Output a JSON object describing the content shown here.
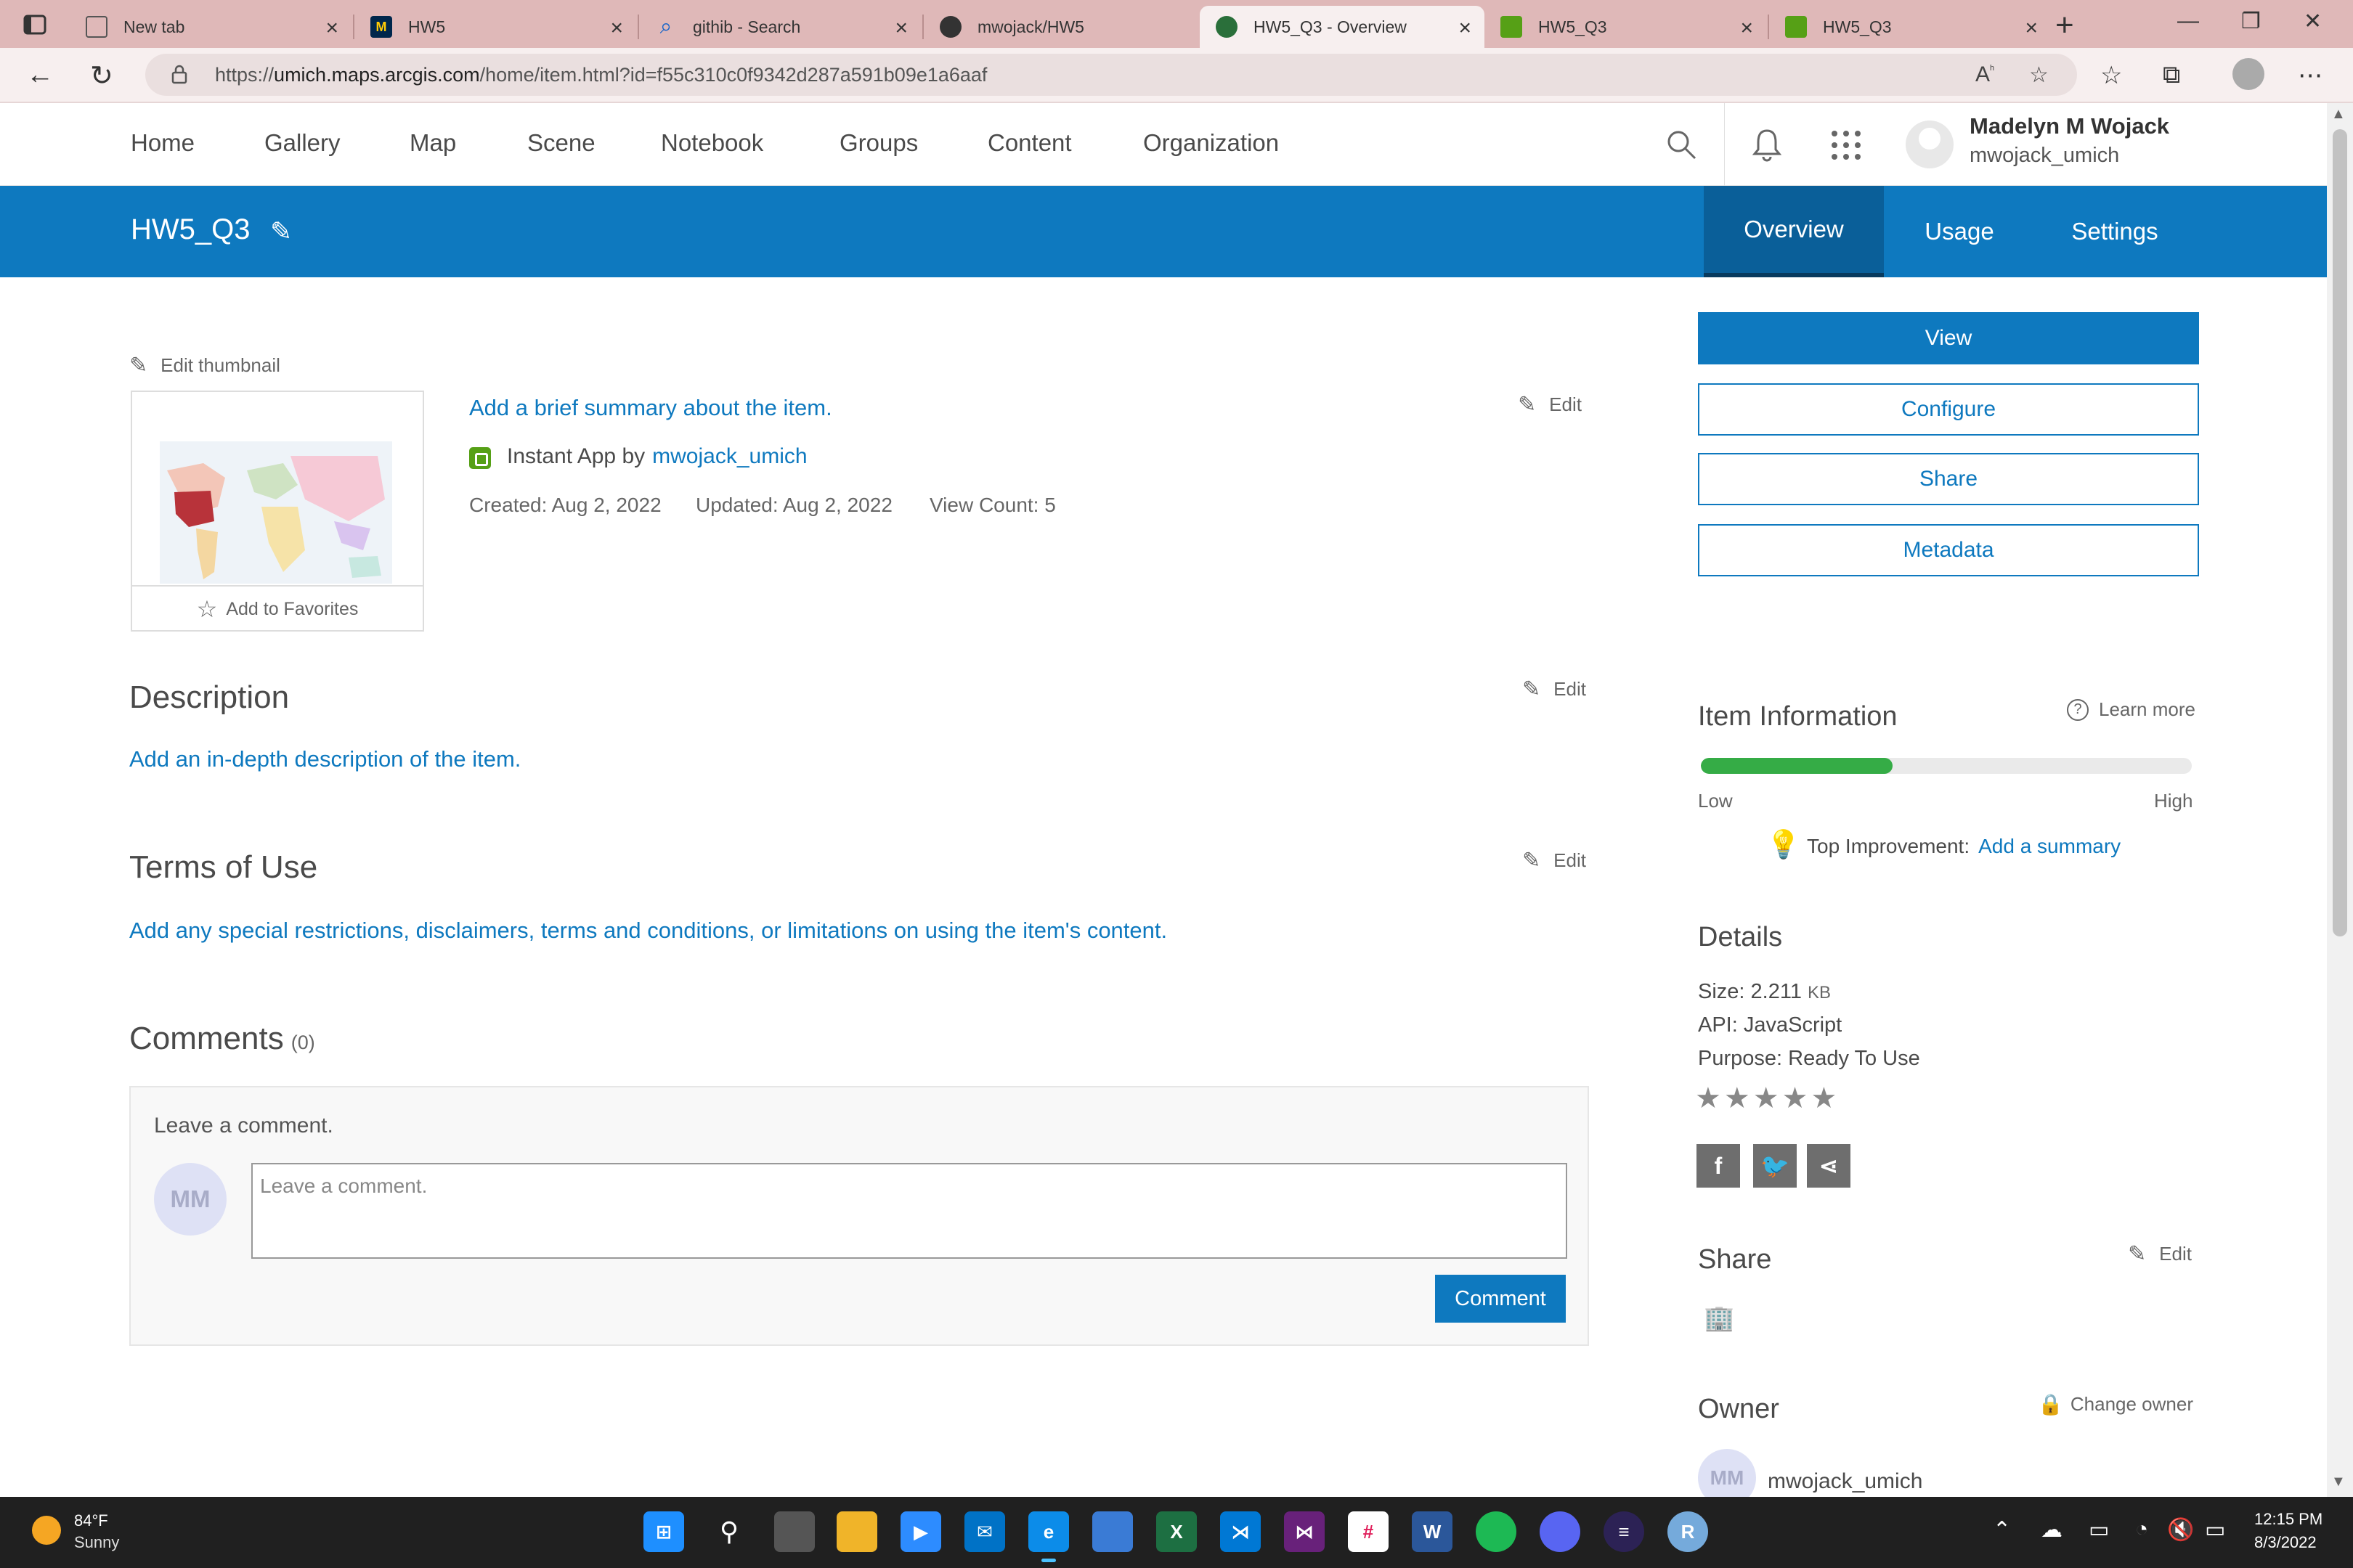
{
  "browser": {
    "tabs": [
      {
        "title": "New tab",
        "favicon": "new-tab-icon"
      },
      {
        "title": "HW5",
        "favicon": "umich-icon"
      },
      {
        "title": "githib - Search",
        "favicon": "search-icon"
      },
      {
        "title": "mwojack/HW5",
        "favicon": "github-icon"
      },
      {
        "title": "HW5_Q3 - Overview",
        "favicon": "arcgis-globe-icon",
        "active": true
      },
      {
        "title": "HW5_Q3",
        "favicon": "instant-app-icon"
      },
      {
        "title": "HW5_Q3",
        "favicon": "instant-app-icon"
      }
    ],
    "url_prefix": "https://",
    "url_host": "umich.maps.arcgis.com",
    "url_path": "/home/item.html?id=f55c310c0f9342d287a591b09e1a6aaf"
  },
  "header": {
    "nav": [
      "Home",
      "Gallery",
      "Map",
      "Scene",
      "Notebook",
      "Groups",
      "Content",
      "Organization"
    ],
    "user_name": "Madelyn M Wojack",
    "user_id": "mwojack_umich"
  },
  "item": {
    "title": "HW5_Q3",
    "tabs": [
      "Overview",
      "Usage",
      "Settings"
    ],
    "active_tab": "Overview",
    "edit_thumbnail": "Edit thumbnail",
    "add_favorites": "Add to Favorites",
    "summary_prompt": "Add a brief summary about the item.",
    "edit_label": "Edit",
    "type_label": "Instant App by",
    "owner_link": "mwojack_umich",
    "created": "Created: Aug 2, 2022",
    "updated": "Updated: Aug 2, 2022",
    "view_count": "View Count: 5"
  },
  "description": {
    "title": "Description",
    "prompt": "Add an in-depth description of the item."
  },
  "terms": {
    "title": "Terms of Use",
    "prompt": "Add any special restrictions, disclaimers, terms and conditions, or limitations on using the item's content."
  },
  "comments": {
    "title": "Comments",
    "count": "(0)",
    "leave_label": "Leave a comment.",
    "avatar_initials": "MM",
    "placeholder": "Leave a comment.",
    "button": "Comment"
  },
  "sidebar": {
    "view": "View",
    "configure": "Configure",
    "share": "Share",
    "metadata": "Metadata",
    "item_info_title": "Item Information",
    "learn_more": "Learn more",
    "info_level": 0.39,
    "low": "Low",
    "high": "High",
    "top_improvement": "Top Improvement:",
    "add_summary": "Add a summary",
    "details_title": "Details",
    "size": "Size: 2.211",
    "size_unit": "KB",
    "api": "API: JavaScript",
    "purpose": "Purpose: Ready To Use",
    "rating": 0,
    "share_title": "Share",
    "share_edit": "Edit",
    "owner_title": "Owner",
    "change_owner": "Change owner",
    "owner_initials": "MM",
    "owner_name": "mwojack_umich"
  },
  "taskbar": {
    "temp": "84°F",
    "condition": "Sunny",
    "time": "12:15 PM",
    "date": "8/3/2022"
  },
  "colors": {
    "accent": "#0e79bf",
    "progress": "#35ac46",
    "tabstrip": "#dfb8b8"
  }
}
